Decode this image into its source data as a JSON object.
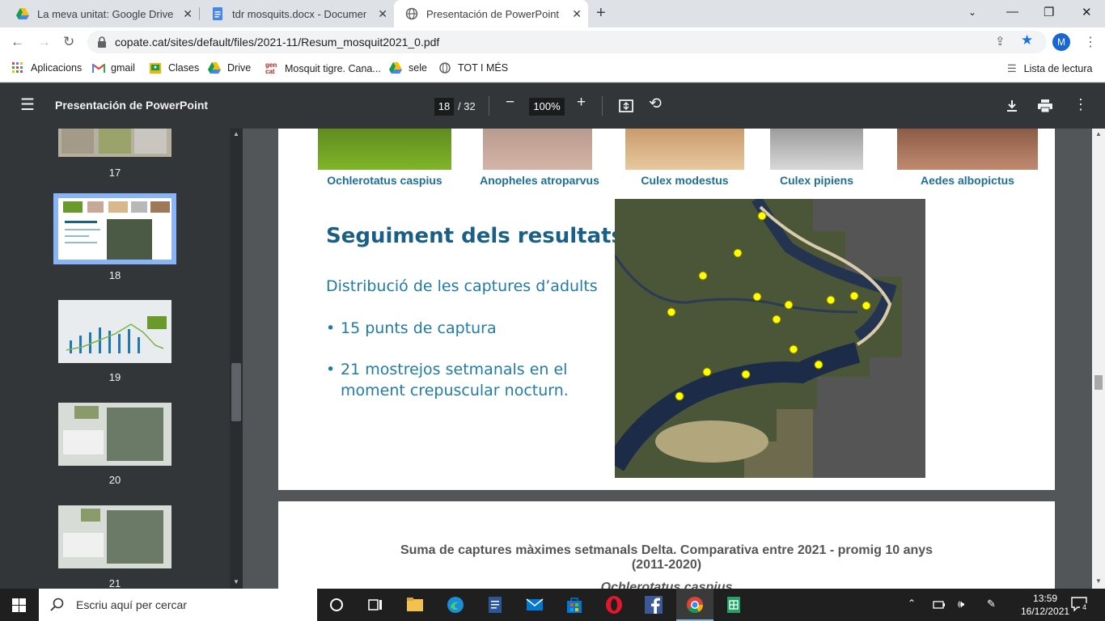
{
  "tabs": [
    {
      "title": "La meva unitat: Google Drive",
      "icon": "google-drive-icon"
    },
    {
      "title": "tdr mosquits.docx - Documents de Google",
      "icon": "google-docs-icon"
    },
    {
      "title": "Presentación de PowerPoint",
      "icon": "globe-icon",
      "active": true
    }
  ],
  "omnibar": {
    "url": "copate.cat/sites/default/files/2021-11/Resum_mosquit2021_0.pdf",
    "profile_initial": "M"
  },
  "bookmarks": {
    "items": [
      "Aplicacions",
      "gmail",
      "Clases",
      "Drive",
      "Mosquit tigre. Cana...",
      "sele",
      "TOT I MÉS"
    ],
    "reading_list": "Lista de lectura"
  },
  "pdf": {
    "title": "Presentación de PowerPoint",
    "current_page": "18",
    "total_pages": "/ 32",
    "zoom": "100%"
  },
  "sidebar": {
    "thumbnails": [
      {
        "num": "17"
      },
      {
        "num": "18",
        "selected": true
      },
      {
        "num": "19"
      },
      {
        "num": "20"
      },
      {
        "num": "21"
      }
    ]
  },
  "slide": {
    "species": [
      "Ochlerotatus caspius",
      "Anopheles atroparvus",
      "Culex modestus",
      "Culex pipiens",
      "Aedes albopictus"
    ],
    "title": "Seguiment dels resultats",
    "subtitle": "Distribució de les captures d’adults",
    "bullet1": "15 punts de captura",
    "bullet2_line1": "21 mostrejos setmanals en el",
    "bullet2_line2": "moment crepuscular nocturn.",
    "bullet_char": "•"
  },
  "next_slide": {
    "title_line1": "Suma de captures màximes setmanals Delta. Comparativa entre 2021 - promig 10 anys",
    "title_line2": "(2011-2020)",
    "species_partial": "Ochlerotatus caspius"
  },
  "taskbar": {
    "search_placeholder": "Escriu aquí per cercar",
    "time": "13:59",
    "date": "16/12/2021",
    "notifications": "4"
  },
  "colors": {
    "accent_blue": "#1a73e8",
    "slide_title": "#1a5f86",
    "slide_text": "#1f7ca8",
    "pdf_toolbar": "#323639"
  }
}
